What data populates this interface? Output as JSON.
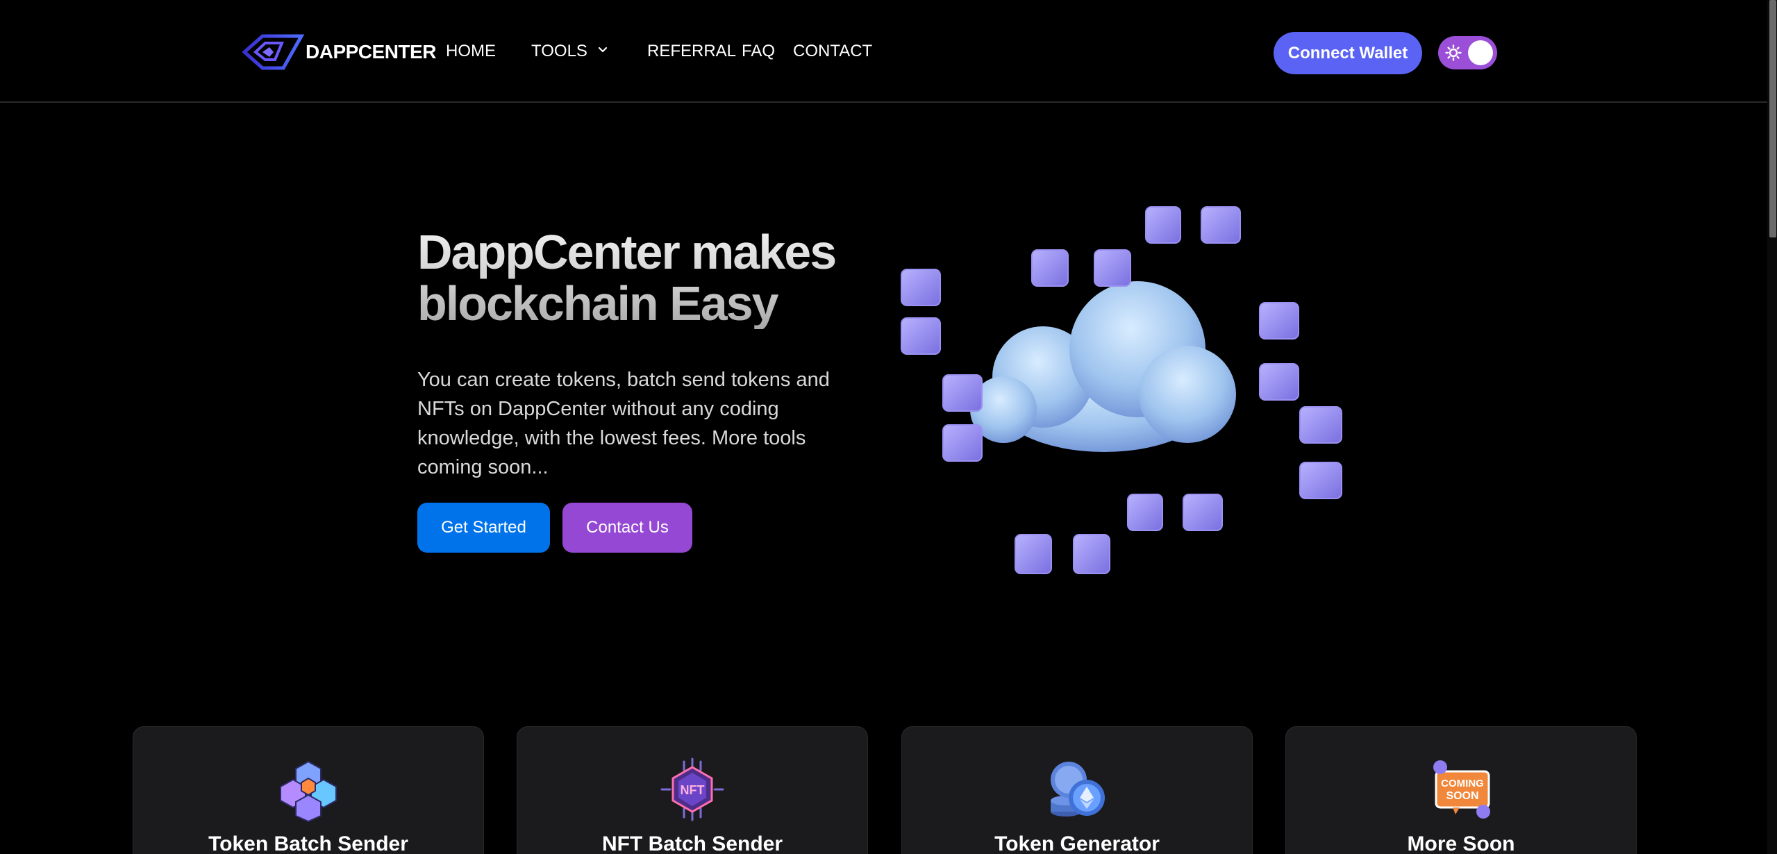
{
  "brand": {
    "name": "DAPPCENTER"
  },
  "nav": {
    "home": "HOME",
    "tools": "TOOLS",
    "referral": "REFERRAL",
    "faq": "FAQ",
    "contact": "CONTACT"
  },
  "header": {
    "connect_wallet": "Connect Wallet"
  },
  "hero": {
    "title": "DappCenter makes blockchain Easy",
    "description": "You can create tokens, batch send tokens and NFTs on DappCenter without any coding knowledge, with the lowest fees. More tools coming soon...",
    "primary_button": "Get Started",
    "secondary_button": "Contact Us"
  },
  "cards": [
    {
      "title": "Token Batch Sender",
      "icon": "token-cubes-icon"
    },
    {
      "title": "NFT Batch Sender",
      "icon": "nft-chip-icon"
    },
    {
      "title": "Token Generator",
      "icon": "coin-stack-icon"
    },
    {
      "title": "More Soon",
      "icon": "coming-soon-icon"
    }
  ],
  "colors": {
    "background": "#000000",
    "connect_wallet": "#5b63f5",
    "toggle": "#9b4fd8",
    "primary": "#0073ea",
    "secondary": "#9548d3",
    "card_bg": "#1b1b1d"
  }
}
